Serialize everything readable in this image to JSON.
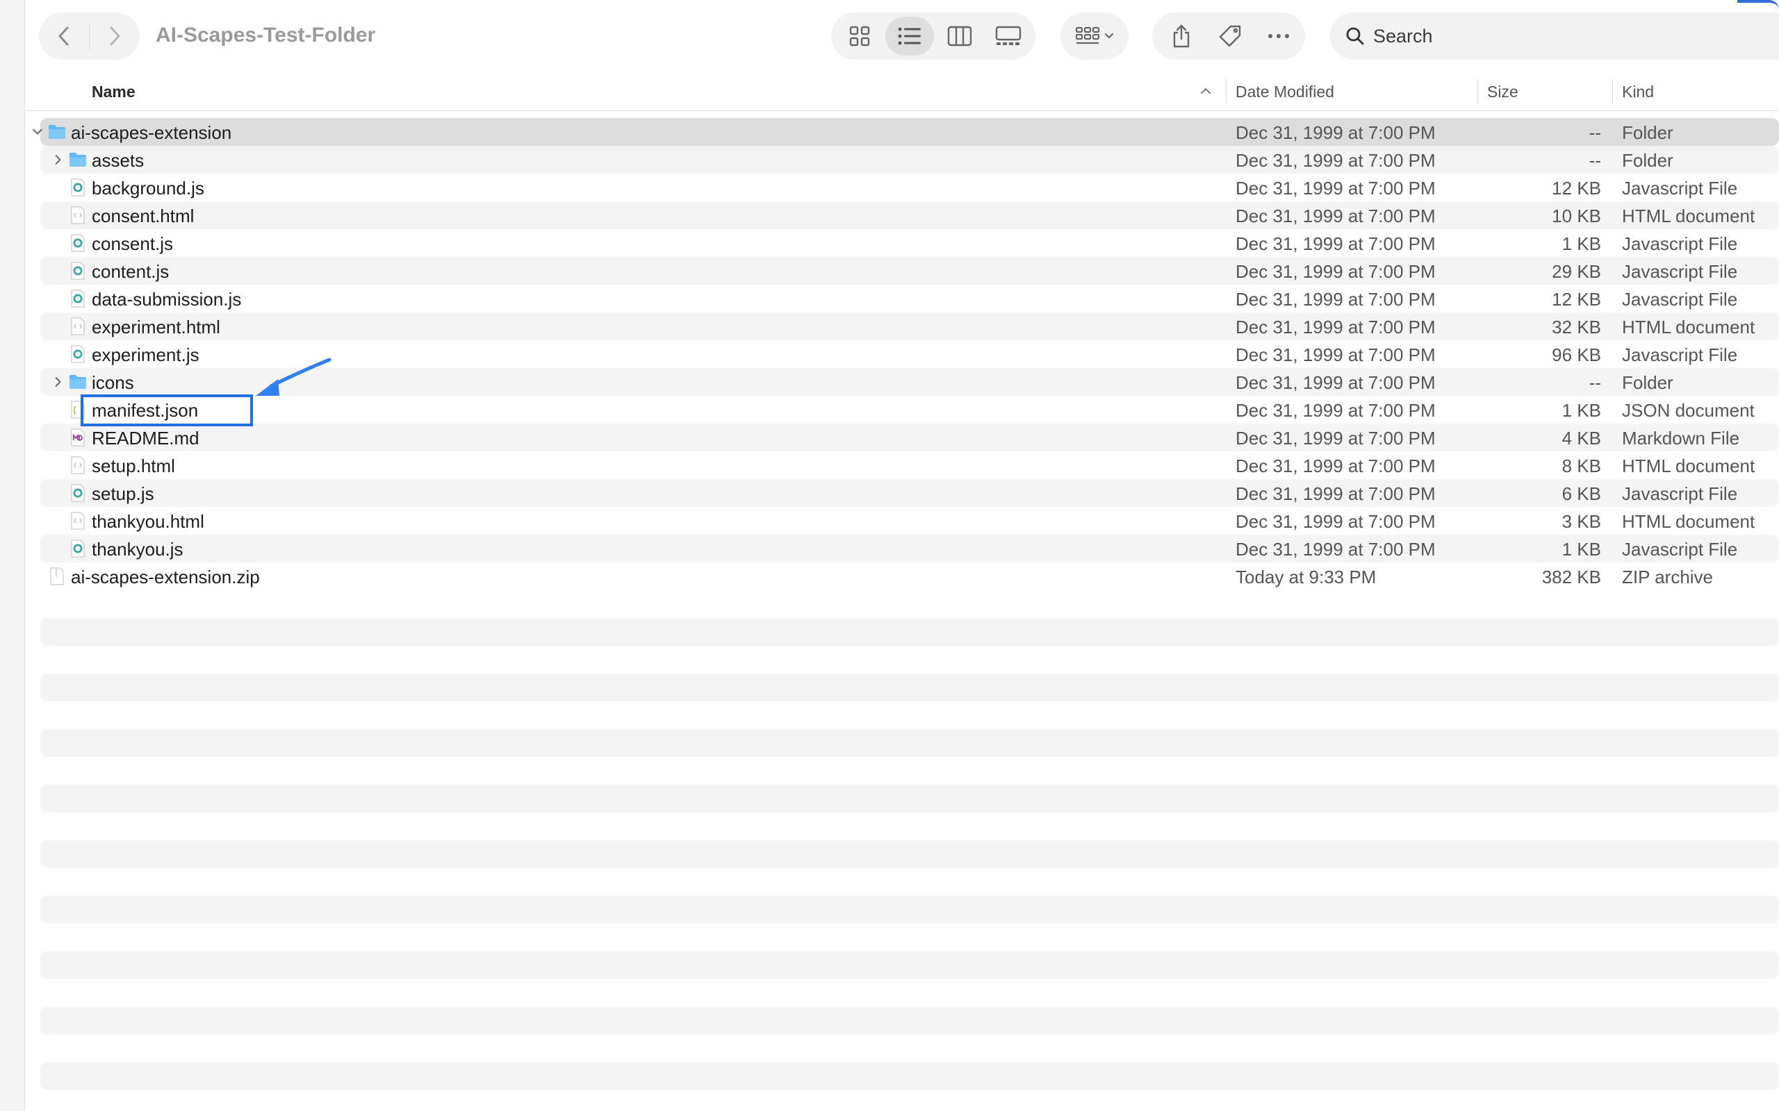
{
  "window": {
    "title": "AI-Scapes-Test-Folder"
  },
  "search": {
    "placeholder": "Search"
  },
  "columns": {
    "name": "Name",
    "date": "Date Modified",
    "size": "Size",
    "kind": "Kind"
  },
  "colors": {
    "accent": "#1f6fe5",
    "folder": "#5fb6f2",
    "selected_row": "#dcdcdc",
    "stripe": "#f4f4f4"
  },
  "toolbar_icons": {
    "back": "chevron-left-icon",
    "forward": "chevron-right-icon",
    "views": [
      "icon-view-icon",
      "list-view-icon",
      "column-view-icon",
      "gallery-view-icon"
    ],
    "active_view": "list-view-icon",
    "group": "group-by-icon",
    "share": "share-icon",
    "tag": "tag-icon",
    "more": "more-icon",
    "search": "search-icon"
  },
  "files": [
    {
      "name": "ai-scapes-extension",
      "date": "Dec 31, 1999 at 7:00 PM",
      "size": "--",
      "kind": "Folder",
      "icon": "folder-icon",
      "level": 0,
      "expandable": true,
      "expanded": true,
      "selected": true
    },
    {
      "name": "assets",
      "date": "Dec 31, 1999 at 7:00 PM",
      "size": "--",
      "kind": "Folder",
      "icon": "folder-icon",
      "level": 1,
      "expandable": true,
      "expanded": false
    },
    {
      "name": "background.js",
      "date": "Dec 31, 1999 at 7:00 PM",
      "size": "12 KB",
      "kind": "Javascript File",
      "icon": "js-file-icon",
      "level": 1
    },
    {
      "name": "consent.html",
      "date": "Dec 31, 1999 at 7:00 PM",
      "size": "10 KB",
      "kind": "HTML document",
      "icon": "html-file-icon",
      "level": 1
    },
    {
      "name": "consent.js",
      "date": "Dec 31, 1999 at 7:00 PM",
      "size": "1 KB",
      "kind": "Javascript File",
      "icon": "js-file-icon",
      "level": 1
    },
    {
      "name": "content.js",
      "date": "Dec 31, 1999 at 7:00 PM",
      "size": "29 KB",
      "kind": "Javascript File",
      "icon": "js-file-icon",
      "level": 1
    },
    {
      "name": "data-submission.js",
      "date": "Dec 31, 1999 at 7:00 PM",
      "size": "12 KB",
      "kind": "Javascript File",
      "icon": "js-file-icon",
      "level": 1
    },
    {
      "name": "experiment.html",
      "date": "Dec 31, 1999 at 7:00 PM",
      "size": "32 KB",
      "kind": "HTML document",
      "icon": "html-file-icon",
      "level": 1
    },
    {
      "name": "experiment.js",
      "date": "Dec 31, 1999 at 7:00 PM",
      "size": "96 KB",
      "kind": "Javascript File",
      "icon": "js-file-icon",
      "level": 1
    },
    {
      "name": "icons",
      "date": "Dec 31, 1999 at 7:00 PM",
      "size": "--",
      "kind": "Folder",
      "icon": "folder-icon",
      "level": 1,
      "expandable": true,
      "expanded": false
    },
    {
      "name": "manifest.json",
      "date": "Dec 31, 1999 at 7:00 PM",
      "size": "1 KB",
      "kind": "JSON document",
      "icon": "json-file-icon",
      "level": 1,
      "highlighted": true
    },
    {
      "name": "README.md",
      "date": "Dec 31, 1999 at 7:00 PM",
      "size": "4 KB",
      "kind": "Markdown File",
      "icon": "markdown-file-icon",
      "level": 1
    },
    {
      "name": "setup.html",
      "date": "Dec 31, 1999 at 7:00 PM",
      "size": "8 KB",
      "kind": "HTML document",
      "icon": "html-file-icon",
      "level": 1
    },
    {
      "name": "setup.js",
      "date": "Dec 31, 1999 at 7:00 PM",
      "size": "6 KB",
      "kind": "Javascript File",
      "icon": "js-file-icon",
      "level": 1
    },
    {
      "name": "thankyou.html",
      "date": "Dec 31, 1999 at 7:00 PM",
      "size": "3 KB",
      "kind": "HTML document",
      "icon": "html-file-icon",
      "level": 1
    },
    {
      "name": "thankyou.js",
      "date": "Dec 31, 1999 at 7:00 PM",
      "size": "1 KB",
      "kind": "Javascript File",
      "icon": "js-file-icon",
      "level": 1
    },
    {
      "name": "ai-scapes-extension.zip",
      "date": "Today at 9:33 PM",
      "size": "382 KB",
      "kind": "ZIP archive",
      "icon": "zip-file-icon",
      "level": 0
    }
  ]
}
